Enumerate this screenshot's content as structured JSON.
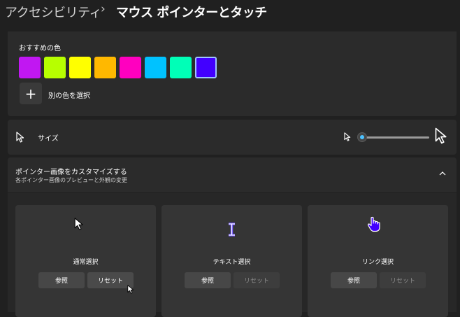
{
  "breadcrumb": {
    "parent": "アクセシビリティ",
    "separator": "›",
    "current": "マウス ポインターとタッチ"
  },
  "colors": {
    "title": "おすすめの色",
    "swatches": [
      "#c117f2",
      "#b7ff00",
      "#ffff00",
      "#ffb800",
      "#ff00bf",
      "#00c2ff",
      "#00ffb7",
      "#4200ff"
    ],
    "selected_index": 7,
    "add_icon": "+",
    "add_label": "別の色を選択"
  },
  "size": {
    "label": "サイズ",
    "slider_value": 1,
    "slider_min": 1,
    "slider_max": 15,
    "accent": "#4cc2ff"
  },
  "custom": {
    "title": "ポインター画像をカスタマイズする",
    "subtitle": "各ポインター画像のプレビューと外観の変更",
    "expanded": true,
    "tiles": [
      {
        "label": "通常選択",
        "icon": "arrow-cursor-icon",
        "browse": "参照",
        "reset": "リセット",
        "reset_enabled": true
      },
      {
        "label": "テキスト選択",
        "icon": "text-beam-icon",
        "browse": "参照",
        "reset": "リセット",
        "reset_enabled": false
      },
      {
        "label": "リンク選択",
        "icon": "hand-cursor-icon",
        "browse": "参照",
        "reset": "リセット",
        "reset_enabled": false
      }
    ]
  },
  "accent_color": "#4200ff"
}
